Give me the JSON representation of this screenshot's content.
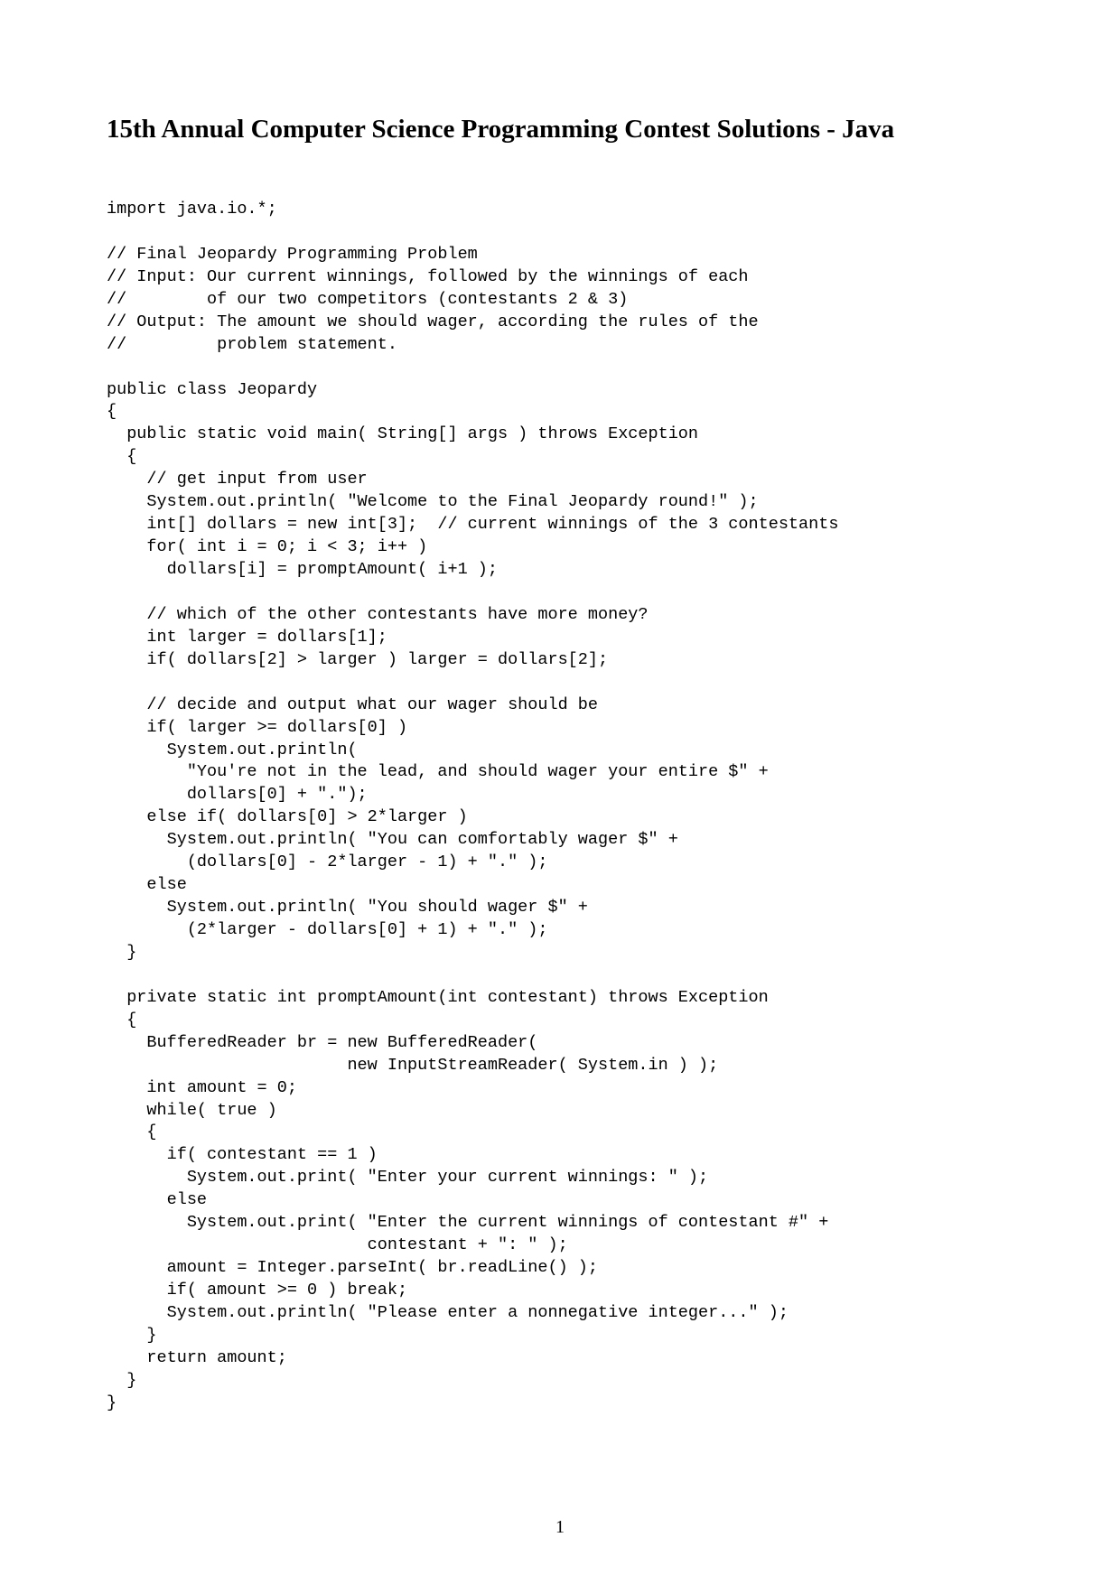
{
  "document": {
    "title": "15th Annual Computer Science Programming Contest Solutions - Java",
    "code_lines": [
      "import java.io.*;",
      "",
      "// Final Jeopardy Programming Problem",
      "// Input: Our current winnings, followed by the winnings of each",
      "//        of our two competitors (contestants 2 & 3)",
      "// Output: The amount we should wager, according the rules of the",
      "//         problem statement.",
      "",
      "public class Jeopardy",
      "{",
      "  public static void main( String[] args ) throws Exception",
      "  {",
      "    // get input from user",
      "    System.out.println( \"Welcome to the Final Jeopardy round!\" );",
      "    int[] dollars = new int[3];  // current winnings of the 3 contestants",
      "    for( int i = 0; i < 3; i++ )",
      "      dollars[i] = promptAmount( i+1 );",
      "",
      "    // which of the other contestants have more money?",
      "    int larger = dollars[1];",
      "    if( dollars[2] > larger ) larger = dollars[2];",
      "",
      "    // decide and output what our wager should be",
      "    if( larger >= dollars[0] )",
      "      System.out.println(",
      "        \"You're not in the lead, and should wager your entire $\" +",
      "        dollars[0] + \".\");",
      "    else if( dollars[0] > 2*larger )",
      "      System.out.println( \"You can comfortably wager $\" +",
      "        (dollars[0] - 2*larger - 1) + \".\" );",
      "    else",
      "      System.out.println( \"You should wager $\" +",
      "        (2*larger - dollars[0] + 1) + \".\" );",
      "  }",
      "",
      "  private static int promptAmount(int contestant) throws Exception",
      "  {",
      "    BufferedReader br = new BufferedReader(",
      "                        new InputStreamReader( System.in ) );",
      "    int amount = 0;",
      "    while( true )",
      "    {",
      "      if( contestant == 1 )",
      "        System.out.print( \"Enter your current winnings: \" );",
      "      else",
      "        System.out.print( \"Enter the current winnings of contestant #\" +",
      "                          contestant + \": \" );",
      "      amount = Integer.parseInt( br.readLine() );",
      "      if( amount >= 0 ) break;",
      "      System.out.println( \"Please enter a nonnegative integer...\" );",
      "    }",
      "    return amount;",
      "  }",
      "}"
    ],
    "page_number": "1"
  }
}
